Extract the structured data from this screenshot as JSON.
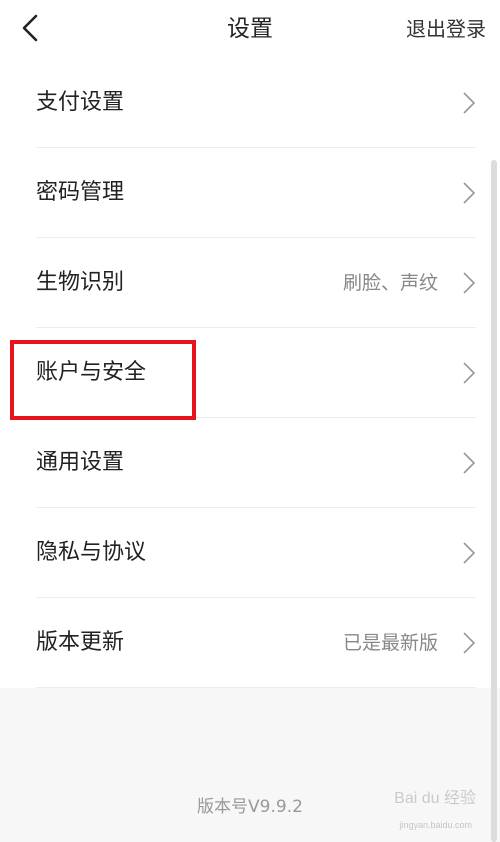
{
  "header": {
    "back_icon": "chevron-left-icon",
    "title": "设置",
    "logout_label": "退出登录"
  },
  "menu": [
    {
      "key": "payment",
      "label": "支付设置",
      "value": ""
    },
    {
      "key": "password",
      "label": "密码管理",
      "value": ""
    },
    {
      "key": "biometric",
      "label": "生物识别",
      "value": "刷脸、声纹"
    },
    {
      "key": "account-security",
      "label": "账户与安全",
      "value": ""
    },
    {
      "key": "general",
      "label": "通用设置",
      "value": ""
    },
    {
      "key": "privacy",
      "label": "隐私与协议",
      "value": ""
    },
    {
      "key": "version-update",
      "label": "版本更新",
      "value": "已是最新版"
    }
  ],
  "highlight_color": "#e8131b",
  "version_text": "版本号V9.9.2",
  "watermark": {
    "text": "Bai du 经验",
    "sub": "jingyan.baidu.com"
  }
}
